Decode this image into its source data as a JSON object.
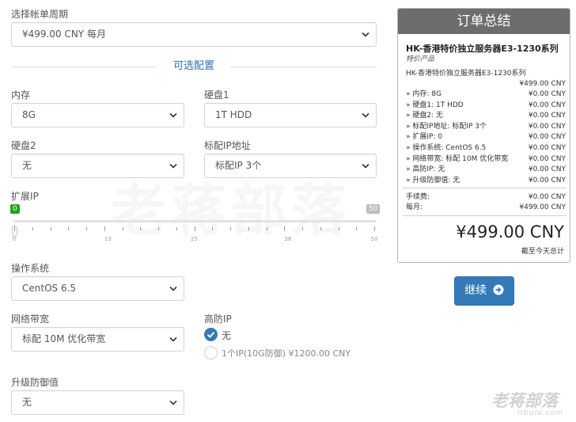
{
  "billing": {
    "label": "选择帐单周期",
    "value": "¥499.00 CNY 每月"
  },
  "section_title": "可选配置",
  "memory": {
    "label": "内存",
    "value": "8G"
  },
  "disk1": {
    "label": "硬盘1",
    "value": "1T HDD"
  },
  "disk2": {
    "label": "硬盘2",
    "value": "无"
  },
  "ip": {
    "label": "标配IP地址",
    "value": "标配IP 3个"
  },
  "extra_ip": {
    "label": "扩展IP",
    "value": "0",
    "max_label": "50",
    "min": 0,
    "max": 50,
    "current": 0,
    "ticks": [
      "0",
      "13",
      "25",
      "38",
      "50"
    ]
  },
  "os": {
    "label": "操作系统",
    "value": "CentOS 6.5"
  },
  "bandwidth": {
    "label": "网络带宽",
    "value": "标配 10M 优化带宽"
  },
  "ddos_ip": {
    "label": "高防IP",
    "options": [
      {
        "label": "无",
        "selected": true
      },
      {
        "label": "1个IP(10G防御) ¥1200.00 CNY",
        "selected": false
      }
    ]
  },
  "ddos_upgrade": {
    "label": "升级防御值",
    "value": "无"
  },
  "summary": {
    "title": "订单总结",
    "product_name": "HK-香港特价独立服务器E3-1230系列",
    "product_group": "特价产品",
    "product_line": "HK-香港特价独立服务器E3-1230系列",
    "base_price": "¥499.00 CNY",
    "items": [
      {
        "label": "» 内存: 8G",
        "value": "¥0.00 CNY"
      },
      {
        "label": "» 硬盘1: 1T HDD",
        "value": "¥0.00 CNY"
      },
      {
        "label": "» 硬盘2: 无",
        "value": "¥0.00 CNY"
      },
      {
        "label": "» 标配IP地址: 标配IP 3个",
        "value": "¥0.00 CNY"
      },
      {
        "label": "» 扩展IP: 0",
        "value": "¥0.00 CNY"
      },
      {
        "label": "» 操作系统: CentOS 6.5",
        "value": "¥0.00 CNY"
      },
      {
        "label": "» 网络带宽: 标配 10M 优化带宽",
        "value": "¥0.00 CNY"
      },
      {
        "label": "» 高防IP: 无",
        "value": "¥0.00 CNY"
      },
      {
        "label": "» 升级防御值: 无",
        "value": "¥0.00 CNY"
      }
    ],
    "setup_fee_label": "手续费:",
    "setup_fee": "¥0.00 CNY",
    "monthly_label": "每月:",
    "monthly": "¥499.00 CNY",
    "total": "¥499.00 CNY",
    "total_note": "截至今天总计"
  },
  "continue_label": "继续",
  "watermark": {
    "big": "老蒋部落",
    "logo": "老蒋部落",
    "url": "itbulu.com"
  },
  "colors": {
    "accent": "#337ab7",
    "bubble_min": "#22a31c",
    "bubble_max": "#bdbdbd",
    "panel_head": "#6d6d6d"
  }
}
